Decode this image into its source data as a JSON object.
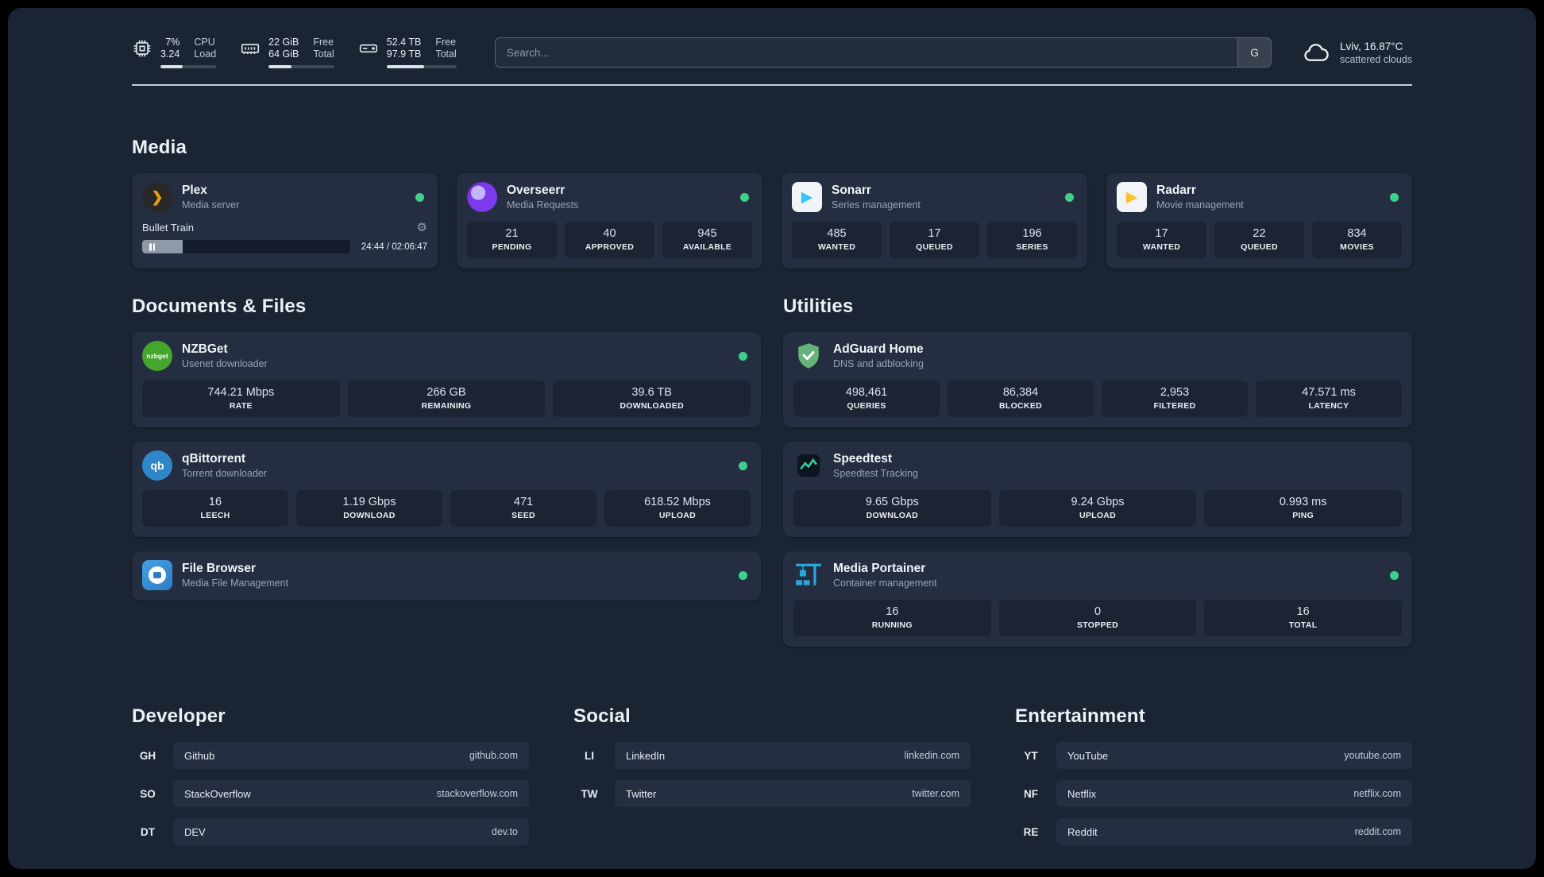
{
  "topbar": {
    "cpu": {
      "v1": "7%",
      "l1": "CPU",
      "v2": "3.24",
      "l2": "Load",
      "percent": 40
    },
    "mem": {
      "v1": "22 GiB",
      "l1": "Free",
      "v2": "64 GiB",
      "l2": "Total",
      "percent": 35
    },
    "disk": {
      "v1": "52.4 TB",
      "l1": "Free",
      "v2": "97.9 TB",
      "l2": "Total",
      "percent": 54
    },
    "search": {
      "placeholder": "Search...",
      "button_label": "G"
    },
    "weather": {
      "location": "Lviv, 16.87°C",
      "condition": "scattered clouds"
    }
  },
  "media": {
    "title": "Media",
    "plex": {
      "name": "Plex",
      "desc": "Media server",
      "status": "online",
      "player": {
        "title": "Bullet Train",
        "time": "24:44 / 02:06:47",
        "progress": 19.5
      }
    },
    "overseerr": {
      "name": "Overseerr",
      "desc": "Media Requests",
      "status": "online",
      "stats": [
        {
          "v": "21",
          "l": "PENDING"
        },
        {
          "v": "40",
          "l": "APPROVED"
        },
        {
          "v": "945",
          "l": "AVAILABLE"
        }
      ]
    },
    "sonarr": {
      "name": "Sonarr",
      "desc": "Series management",
      "status": "online",
      "stats": [
        {
          "v": "485",
          "l": "WANTED"
        },
        {
          "v": "17",
          "l": "QUEUED"
        },
        {
          "v": "196",
          "l": "SERIES"
        }
      ]
    },
    "radarr": {
      "name": "Radarr",
      "desc": "Movie management",
      "status": "online",
      "stats": [
        {
          "v": "17",
          "l": "WANTED"
        },
        {
          "v": "22",
          "l": "QUEUED"
        },
        {
          "v": "834",
          "l": "MOVIES"
        }
      ]
    }
  },
  "documents": {
    "title": "Documents & Files",
    "nzbget": {
      "name": "NZBGet",
      "desc": "Usenet downloader",
      "status": "online",
      "icon_text": "nzbget",
      "stats": [
        {
          "v": "744.21 Mbps",
          "l": "RATE"
        },
        {
          "v": "266 GB",
          "l": "REMAINING"
        },
        {
          "v": "39.6 TB",
          "l": "DOWNLOADED"
        }
      ]
    },
    "qbittorrent": {
      "name": "qBittorrent",
      "desc": "Torrent downloader",
      "status": "online",
      "icon_text": "qb",
      "stats": [
        {
          "v": "16",
          "l": "LEECH"
        },
        {
          "v": "1.19 Gbps",
          "l": "DOWNLOAD"
        },
        {
          "v": "471",
          "l": "SEED"
        },
        {
          "v": "618.52 Mbps",
          "l": "UPLOAD"
        }
      ]
    },
    "filebrowser": {
      "name": "File Browser",
      "desc": "Media File Management",
      "status": "online"
    }
  },
  "utilities": {
    "title": "Utilities",
    "adguard": {
      "name": "AdGuard Home",
      "desc": "DNS and adblocking",
      "stats": [
        {
          "v": "498,461",
          "l": "QUERIES"
        },
        {
          "v": "86,384",
          "l": "BLOCKED"
        },
        {
          "v": "2,953",
          "l": "FILTERED"
        },
        {
          "v": "47.571 ms",
          "l": "LATENCY"
        }
      ]
    },
    "speedtest": {
      "name": "Speedtest",
      "desc": "Speedtest Tracking",
      "stats": [
        {
          "v": "9.65 Gbps",
          "l": "DOWNLOAD"
        },
        {
          "v": "9.24 Gbps",
          "l": "UPLOAD"
        },
        {
          "v": "0.993 ms",
          "l": "PING"
        }
      ]
    },
    "portainer": {
      "name": "Media Portainer",
      "desc": "Container management",
      "status": "online",
      "stats": [
        {
          "v": "16",
          "l": "RUNNING"
        },
        {
          "v": "0",
          "l": "STOPPED"
        },
        {
          "v": "16",
          "l": "TOTAL"
        }
      ]
    }
  },
  "bookmarks": {
    "developer": {
      "title": "Developer",
      "items": [
        {
          "abbr": "GH",
          "name": "Github",
          "url": "github.com"
        },
        {
          "abbr": "SO",
          "name": "StackOverflow",
          "url": "stackoverflow.com"
        },
        {
          "abbr": "DT",
          "name": "DEV",
          "url": "dev.to"
        }
      ]
    },
    "social": {
      "title": "Social",
      "items": [
        {
          "abbr": "LI",
          "name": "LinkedIn",
          "url": "linkedin.com"
        },
        {
          "abbr": "TW",
          "name": "Twitter",
          "url": "twitter.com"
        }
      ]
    },
    "entertainment": {
      "title": "Entertainment",
      "items": [
        {
          "abbr": "YT",
          "name": "YouTube",
          "url": "youtube.com"
        },
        {
          "abbr": "NF",
          "name": "Netflix",
          "url": "netflix.com"
        },
        {
          "abbr": "RE",
          "name": "Reddit",
          "url": "reddit.com"
        }
      ]
    }
  },
  "colors": {
    "online": "#3ed18c",
    "plex_accent": "#e5a00d",
    "background": "#1b2433",
    "card": "#242e40"
  }
}
